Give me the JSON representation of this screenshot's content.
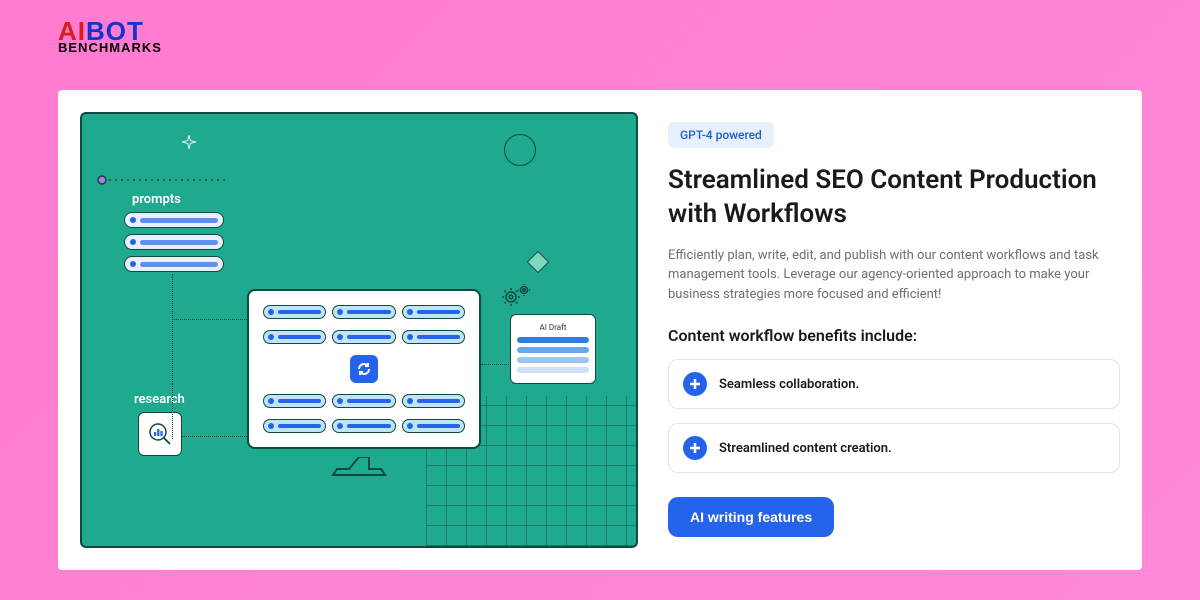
{
  "logo": {
    "ai": "AI",
    "bot": "BOT",
    "bottom": "BENCHMARKS"
  },
  "badge": "GPT-4 powered",
  "heading": "Streamlined SEO Content Production with Workflows",
  "description": "Efficiently plan, write, edit, and publish with our content workflows and task management tools. Leverage our agency-oriented approach to make your business strategies more focused and efficient!",
  "subheading": "Content workflow benefits include:",
  "benefits": [
    "Seamless collaboration.",
    "Streamlined content creation."
  ],
  "cta": "AI writing features",
  "illustration": {
    "prompts_label": "prompts",
    "research_label": "research",
    "draft_label": "AI Draft"
  },
  "colors": {
    "accent": "#2563eb",
    "teal": "#1fa98e",
    "badge_bg": "#e8f0fe",
    "badge_fg": "#1a5fc8"
  }
}
